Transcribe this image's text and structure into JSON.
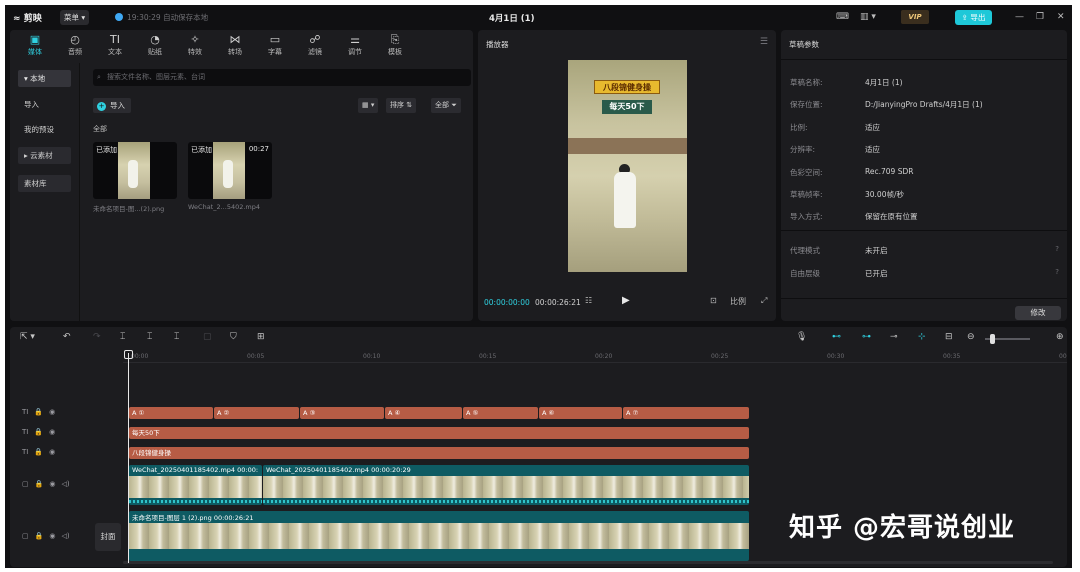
{
  "topbar": {
    "logo": "剪映",
    "menu": "菜单",
    "save_status": "19:30:29 自动保存本地",
    "project_title": "4月1日 (1)",
    "vip": "VIP",
    "export": "导出"
  },
  "media_toolbar": [
    {
      "label": "媒体",
      "icon": "media-icon",
      "glyph": "▣",
      "active": true
    },
    {
      "label": "音频",
      "icon": "audio-icon",
      "glyph": "◴"
    },
    {
      "label": "文本",
      "icon": "text-icon",
      "glyph": "TI"
    },
    {
      "label": "贴纸",
      "icon": "sticker-icon",
      "glyph": "◔"
    },
    {
      "label": "特效",
      "icon": "effects-icon",
      "glyph": "✧"
    },
    {
      "label": "转场",
      "icon": "transition-icon",
      "glyph": "⋈"
    },
    {
      "label": "字幕",
      "icon": "subtitle-icon",
      "glyph": "▭"
    },
    {
      "label": "滤镜",
      "icon": "filter-icon",
      "glyph": "☍"
    },
    {
      "label": "调节",
      "icon": "adjust-icon",
      "glyph": "⚌"
    },
    {
      "label": "模板",
      "icon": "template-icon",
      "glyph": "⎘"
    }
  ],
  "side_nav": [
    {
      "label": "▾ 本地",
      "active": true
    },
    {
      "label": "导入"
    },
    {
      "label": "我的预设"
    },
    {
      "label": "▸ 云素材",
      "boxed": true
    },
    {
      "label": "素材库",
      "boxed": true
    }
  ],
  "media": {
    "search_placeholder": "搜索文件名称、图层元素、台词",
    "import": "导入",
    "sort": "排序",
    "all_filter": "全部",
    "section": "全部",
    "items": [
      {
        "badge": "已添加",
        "duration": "",
        "name": "未命名项目-图...(2).png"
      },
      {
        "badge": "已添加",
        "duration": "00:27",
        "name": "WeChat_2...5402.mp4"
      }
    ]
  },
  "player": {
    "title": "播放器",
    "caption1": "八段锦健身操",
    "caption2": "每天50下",
    "current_time": "00:00:00:00",
    "total_time": "00:00:26:21",
    "ratio_label": "比例"
  },
  "draft": {
    "title": "草稿参数",
    "params": [
      {
        "label": "草稿名称:",
        "value": "4月1日 (1)"
      },
      {
        "label": "保存位置:",
        "value": "D:/JianyingPro Drafts/4月1日 (1)"
      },
      {
        "label": "比例:",
        "value": "适应"
      },
      {
        "label": "分辨率:",
        "value": "适应"
      },
      {
        "label": "色彩空间:",
        "value": "Rec.709 SDR"
      },
      {
        "label": "草稿帧率:",
        "value": "30.00帧/秒"
      },
      {
        "label": "导入方式:",
        "value": "保留在原有位置"
      }
    ],
    "extra": [
      {
        "label": "代理模式",
        "value": "未开启"
      },
      {
        "label": "自由层级",
        "value": "已开启"
      }
    ],
    "edit": "修改"
  },
  "timeline": {
    "ticks": [
      "00:00",
      "00:05",
      "00:10",
      "00:15",
      "00:20",
      "00:25",
      "00:30",
      "00:35",
      "00"
    ],
    "text_clips_row1": [
      "A ①",
      "A ②",
      "A ③",
      "A ④",
      "A ⑤",
      "A ⑥",
      "A ⑦"
    ],
    "text_clip_row2": "每天50下",
    "text_clip_row3": "八段锦健身操",
    "video_clip_a": "WeChat_20250401185402.mp4  00:00:",
    "video_clip_b": "WeChat_20250401185402.mp4  00:00:20:29",
    "image_clip": "未命名项目-图层 1 (2).png  00:00:26:21",
    "cover": "封面"
  },
  "watermark": "知乎 @宏哥说创业"
}
